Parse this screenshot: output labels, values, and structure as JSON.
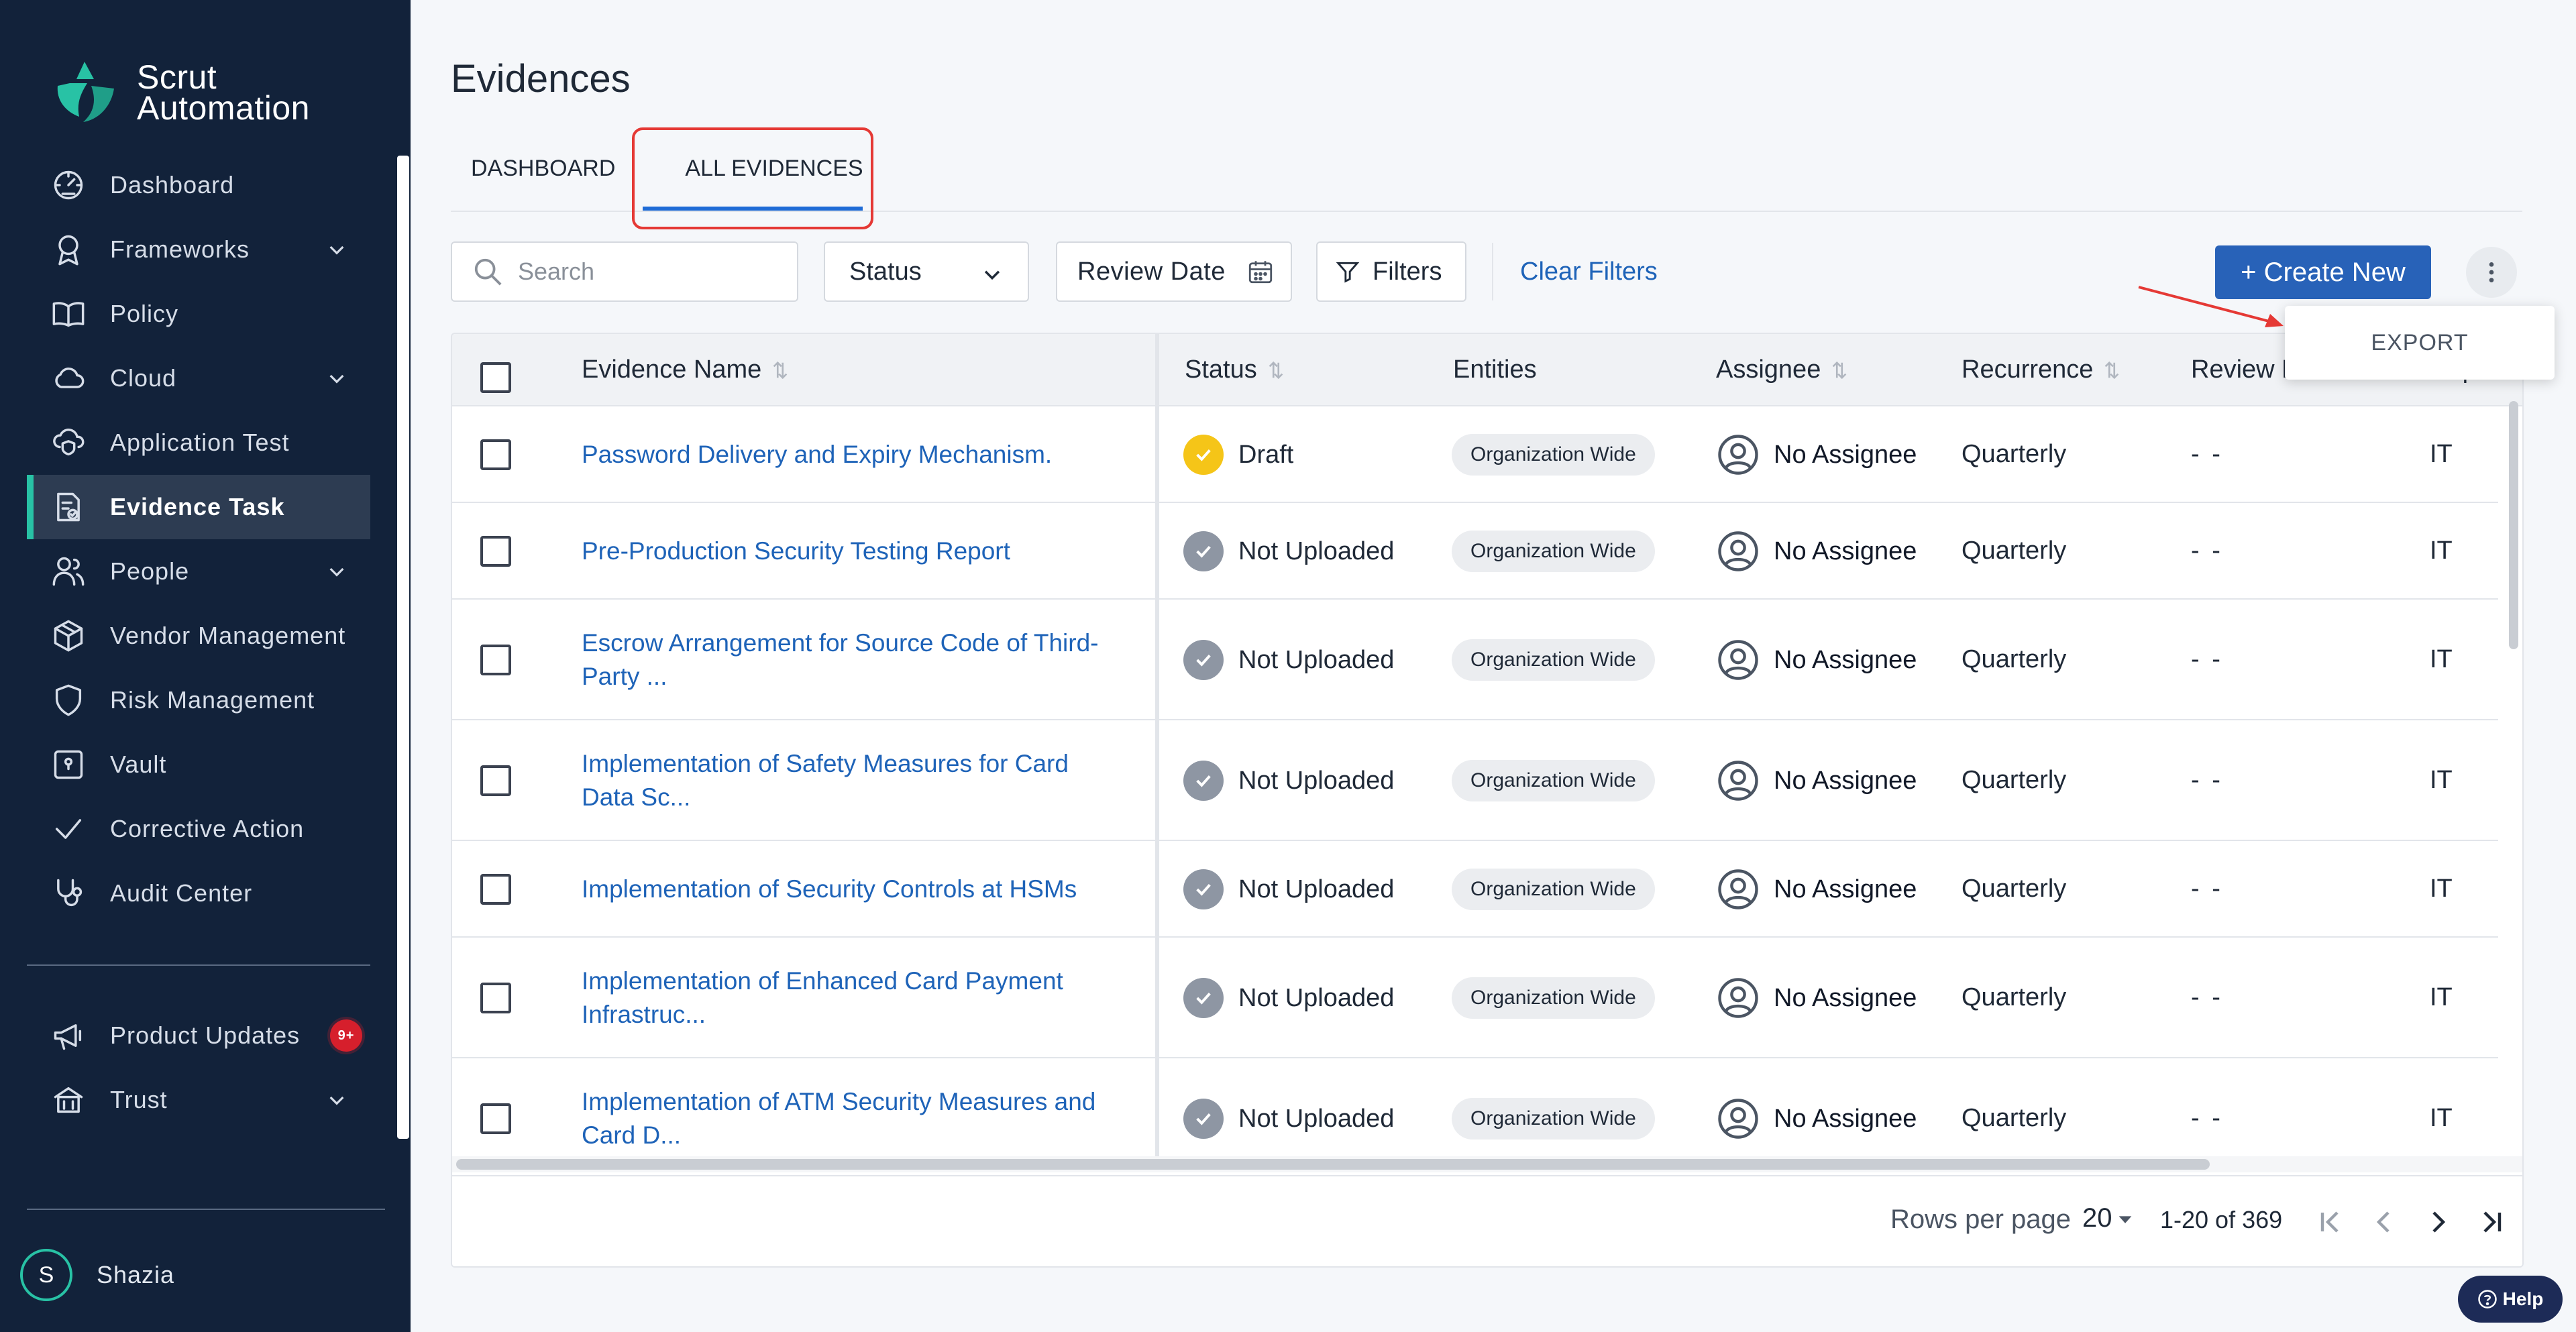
{
  "brand": {
    "line1": "Scrut",
    "line2": "Automation",
    "accent": "#28c2a5"
  },
  "sidebar": {
    "items": [
      {
        "label": "Dashboard",
        "icon": "dashboard-gauge-icon",
        "expandable": false
      },
      {
        "label": "Frameworks",
        "icon": "award-ribbon-icon",
        "expandable": true
      },
      {
        "label": "Policy",
        "icon": "open-book-icon",
        "expandable": false
      },
      {
        "label": "Cloud",
        "icon": "cloud-icon",
        "expandable": true
      },
      {
        "label": "Application Test",
        "icon": "cloud-shield-icon",
        "expandable": false
      },
      {
        "label": "Evidence Task",
        "icon": "evidence-doc-icon",
        "expandable": false,
        "active": true
      },
      {
        "label": "People",
        "icon": "people-icon",
        "expandable": true
      },
      {
        "label": "Vendor Management",
        "icon": "cube-icon",
        "expandable": false
      },
      {
        "label": "Risk Management",
        "icon": "shield-icon",
        "expandable": false
      },
      {
        "label": "Vault",
        "icon": "vault-icon",
        "expandable": false
      },
      {
        "label": "Corrective Action",
        "icon": "checkmark-icon",
        "expandable": false
      },
      {
        "label": "Audit Center",
        "icon": "stethoscope-icon",
        "expandable": false
      }
    ],
    "bottom_items": [
      {
        "label": "Product Updates",
        "icon": "megaphone-icon",
        "badge": "9+"
      },
      {
        "label": "Trust",
        "icon": "trust-building-icon",
        "expandable": true
      }
    ],
    "user": {
      "initial": "S",
      "name": "Shazia"
    }
  },
  "page": {
    "title": "Evidences"
  },
  "tabs": [
    {
      "label": "DASHBOARD",
      "active": false
    },
    {
      "label": "ALL EVIDENCES",
      "active": true
    }
  ],
  "toolbar": {
    "search_placeholder": "Search",
    "status_label": "Status",
    "review_date_label": "Review Date",
    "filters_label": "Filters",
    "clear_filters_label": "Clear Filters",
    "create_label": "+ Create New",
    "more_menu": {
      "export_label": "EXPORT"
    }
  },
  "table": {
    "columns": [
      "Evidence Name",
      "Status",
      "Entities",
      "Assignee",
      "Recurrence",
      "Review Date",
      "Department"
    ],
    "rows": [
      {
        "name": "Password Delivery and Expiry Mechanism.",
        "status": "Draft",
        "entity": "Organization Wide",
        "assignee": "No Assignee",
        "recurrence": "Quarterly",
        "review_date": "- -",
        "department": "IT"
      },
      {
        "name": "Pre-Production Security Testing Report",
        "status": "Not Uploaded",
        "entity": "Organization Wide",
        "assignee": "No Assignee",
        "recurrence": "Quarterly",
        "review_date": "- -",
        "department": "IT"
      },
      {
        "name": "Escrow Arrangement for Source Code of Third-Party ...",
        "status": "Not Uploaded",
        "entity": "Organization Wide",
        "assignee": "No Assignee",
        "recurrence": "Quarterly",
        "review_date": "- -",
        "department": "IT"
      },
      {
        "name": "Implementation of Safety Measures for Card Data Sc...",
        "status": "Not Uploaded",
        "entity": "Organization Wide",
        "assignee": "No Assignee",
        "recurrence": "Quarterly",
        "review_date": "- -",
        "department": "IT"
      },
      {
        "name": "Implementation of Security Controls at HSMs",
        "status": "Not Uploaded",
        "entity": "Organization Wide",
        "assignee": "No Assignee",
        "recurrence": "Quarterly",
        "review_date": "- -",
        "department": "IT"
      },
      {
        "name": "Implementation of Enhanced Card Payment Infrastruc...",
        "status": "Not Uploaded",
        "entity": "Organization Wide",
        "assignee": "No Assignee",
        "recurrence": "Quarterly",
        "review_date": "- -",
        "department": "IT"
      },
      {
        "name": "Implementation of ATM Security Measures and Card D...",
        "status": "Not Uploaded",
        "entity": "Organization Wide",
        "assignee": "No Assignee",
        "recurrence": "Quarterly",
        "review_date": "- -",
        "department": "IT"
      }
    ],
    "status_colors": {
      "Draft": "#f5c518",
      "Not Uploaded": "#8e96a3"
    }
  },
  "pagination": {
    "rows_per_page_label": "Rows per page",
    "rows_per_page": "20",
    "range": "1-20 of 369"
  },
  "help": {
    "label": "Help"
  },
  "colors": {
    "sidebar_bg": "#12223a",
    "primary": "#2862b8",
    "link": "#1e63b8",
    "highlight": "#e53935"
  }
}
